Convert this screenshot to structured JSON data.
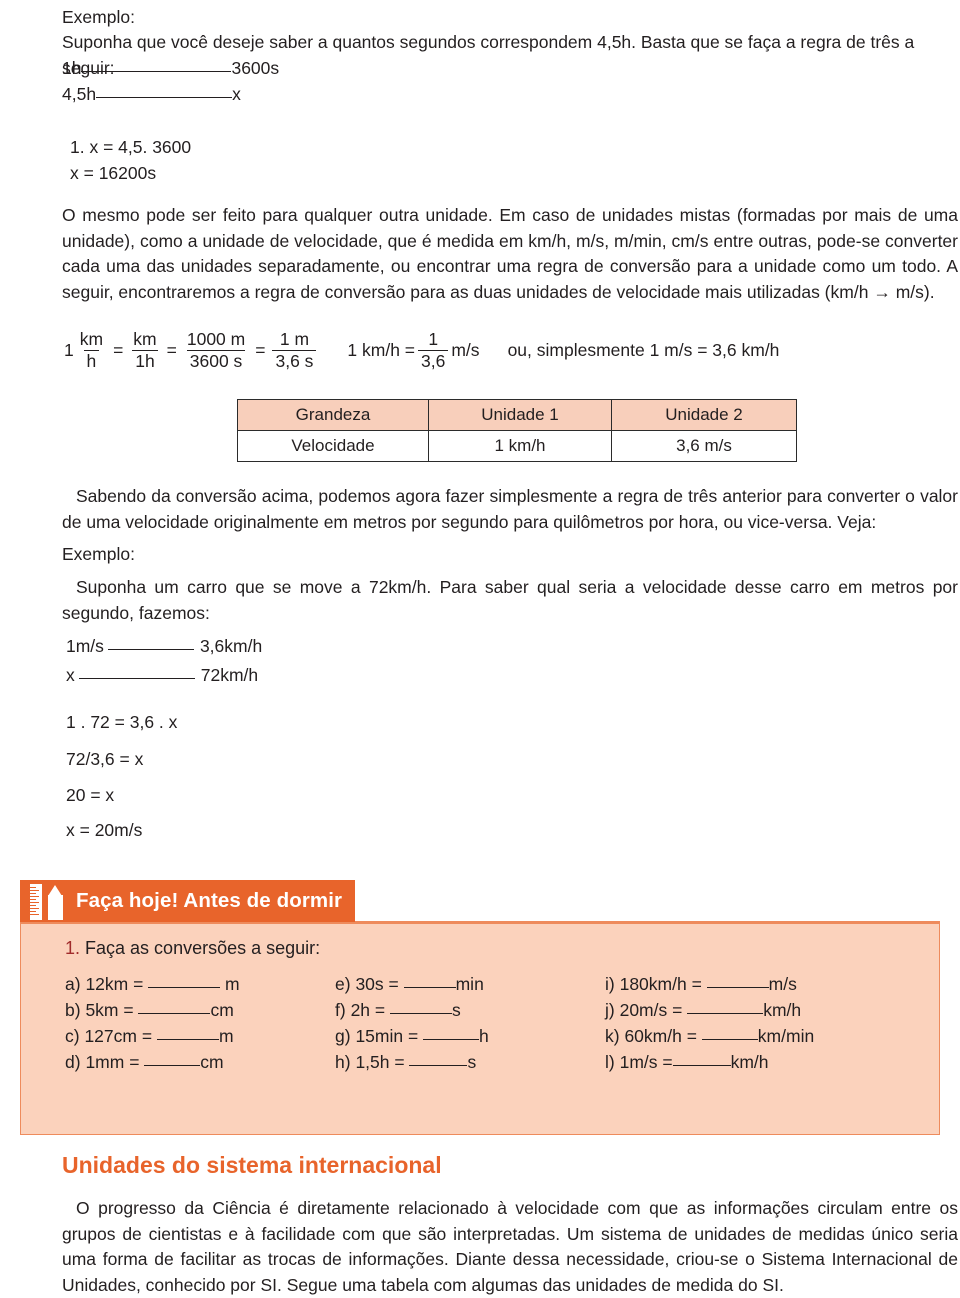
{
  "colors": {
    "accent_orange": "#E8642B",
    "box_fill": "#FBD2BC",
    "box_border": "#EE8B5C",
    "table_header": "#F8CFBB",
    "question_number": "#A02B2B",
    "text": "#231f20"
  },
  "top": {
    "example_label": "Exemplo:",
    "example_intro": "Suponha que você deseje saber a quantos segundos correspondem 4,5h. Basta que se faça a regra de três a seguir:",
    "proportion": [
      {
        "left": "1h",
        "right": "3600s"
      },
      {
        "left": "4,5h",
        "right": "x"
      }
    ],
    "solution": [
      "1. x = 4,5. 3600",
      "x = 16200s"
    ],
    "paragraph": "O mesmo pode ser feito para qualquer outra unidade. Em caso de unidades mistas (formadas por mais de uma unidade), como a unidade de velocidade, que é medida em km/h, m/s, m/min, cm/s entre outras, pode-se converter cada uma das unidades separadamente, ou encontrar uma regra de conversão para a unidade como um todo. A seguir, encontraremos a regra de conversão para as duas unidades de velocidade mais utilizadas (km/h",
    "paragraph_tail": "m/s).",
    "arrow": "→"
  },
  "formula": {
    "lead": "1",
    "f1": {
      "num": "km",
      "den": "h"
    },
    "eq1": "=",
    "f2": {
      "num": "km",
      "den": "1h"
    },
    "eq2": "=",
    "f3": {
      "num": "1000 m",
      "den": "3600 s"
    },
    "eq3": "=",
    "f4": {
      "num": "1 m",
      "den": "3,6 s"
    },
    "second_lead": "1 km/h =",
    "f5": {
      "num": "1",
      "den": "3,6"
    },
    "second_tail": "m/s",
    "note": "ou, simplesmente 1 m/s = 3,6 km/h"
  },
  "table": {
    "headers": [
      "Grandeza",
      "Unidade 1",
      "Unidade 2"
    ],
    "rows": [
      [
        "Velocidade",
        "1 km/h",
        "3,6 m/s"
      ]
    ]
  },
  "middle": {
    "paragraph": "Sabendo da conversão acima, podemos agora fazer simplesmente a regra de três anterior para converter o valor de uma velocidade originalmente em metros por segundo para quilômetros por hora, ou vice-versa. Veja:",
    "example_label": "Exemplo:",
    "example_text": "Suponha um carro que se move a 72km/h. Para saber qual seria a velocidade desse carro em metros por segundo, fazemos:",
    "proportion": [
      {
        "left": "1m/s",
        "right": "3,6km/h"
      },
      {
        "left": "x",
        "right": "72km/h"
      }
    ],
    "steps": [
      "1 . 72 = 3,6 . x",
      "72/3,6 = x",
      "20 = x",
      "x = 20m/s"
    ]
  },
  "activity": {
    "banner_title": "Faça hoje! Antes de dormir",
    "question_number": "1.",
    "question_text": "Faça as conversões a seguir:",
    "exercises_col1": [
      {
        "label": "a)",
        "expr": "12km = ",
        "rule_w": 72,
        "unit": " m"
      },
      {
        "label": "b)",
        "expr": "5km = ",
        "rule_w": 72,
        "unit": "cm"
      },
      {
        "label": "c)",
        "expr": "127cm = ",
        "rule_w": 62,
        "unit": "m"
      },
      {
        "label": "d)",
        "expr": "1mm = ",
        "rule_w": 56,
        "unit": "cm"
      }
    ],
    "exercises_col2": [
      {
        "label": "e)",
        "expr": "30s = ",
        "rule_w": 52,
        "unit": "min"
      },
      {
        "label": "f)",
        "expr": " 2h = ",
        "rule_w": 62,
        "unit": "s"
      },
      {
        "label": "g)",
        "expr": "15min = ",
        "rule_w": 56,
        "unit": "h"
      },
      {
        "label": "h)",
        "expr": "1,5h = ",
        "rule_w": 58,
        "unit": "s"
      }
    ],
    "exercises_col3": [
      {
        "label": "i)",
        "expr": "180km/h = ",
        "rule_w": 62,
        "unit": "m/s"
      },
      {
        "label": "j)",
        "expr": "20m/s = ",
        "rule_w": 76,
        "unit": "km/h"
      },
      {
        "label": "k)",
        "expr": "60km/h = ",
        "rule_w": 56,
        "unit": "km/min"
      },
      {
        "label": "l)",
        "expr": "1m/s =",
        "rule_w": 58,
        "unit": "km/h"
      }
    ]
  },
  "bottom": {
    "section_title": "Unidades do sistema internacional",
    "paragraph": "O progresso da Ciência é diretamente relacionado à velocidade com que as informações circulam entre os grupos de cientistas e à facilidade com que são interpretadas. Um sistema de unidades de medidas único seria uma forma de facilitar as trocas de informações. Diante dessa necessidade, criou-se o Sistema Internacional de Unidades, conhecido por SI. Segue uma tabela com algumas das unidades de medida do SI."
  }
}
